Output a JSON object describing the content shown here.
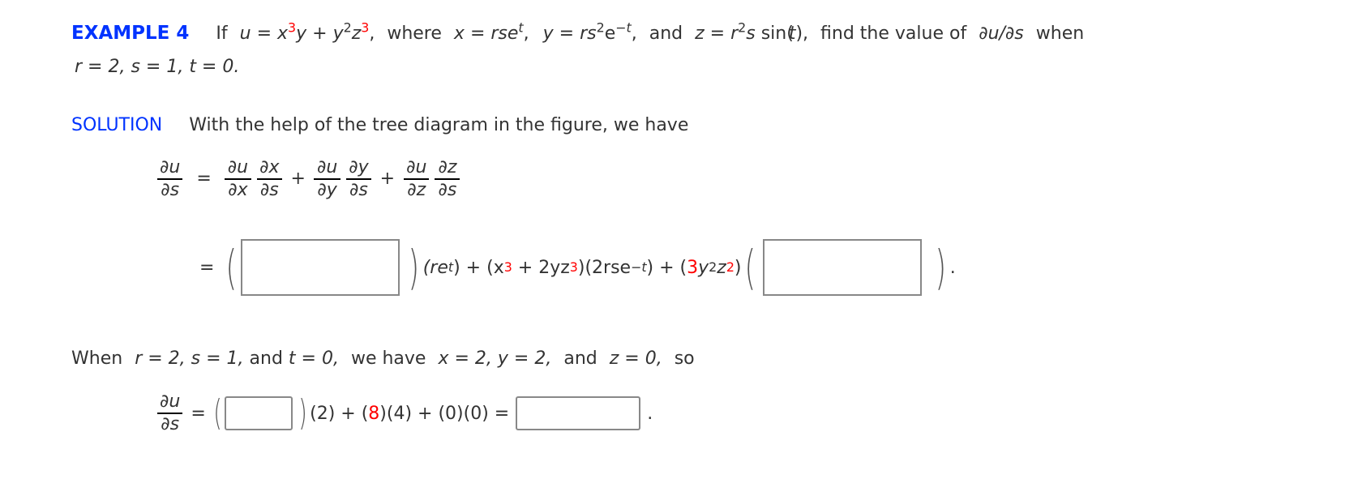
{
  "example": {
    "label": "EXAMPLE 4",
    "if": "If",
    "u": "u",
    "eq": "=",
    "x": "x",
    "sup3": "3",
    "y": "y",
    "plus": "+",
    "sup2": "2",
    "z": "z",
    "comma": ",",
    "where": "where",
    "rse": "rse",
    "t": "t",
    "rs": "rs",
    "e": "e",
    "negt": "−t",
    "and": "and",
    "r": "r",
    "s": "s",
    "sin_open": "sin(",
    "close_paren": ")",
    "find": "find the value of",
    "dudS": "∂u/∂s",
    "when": "when",
    "line2": "r = 2, s = 1, t = 0."
  },
  "solution": {
    "label": "SOLUTION",
    "intro": "With the help of the tree diagram in the figure, we have"
  },
  "chain_rule": {
    "du": "∂u",
    "ds": "∂s",
    "dx": "∂x",
    "dy": "∂y",
    "dz": "∂z",
    "eq": "=",
    "plus": "+"
  },
  "expansion": {
    "eq": "=",
    "term1_open": "(re",
    "term1_sup": "t",
    "term1_close": ") + (x",
    "sup3": "3",
    "mid": " + 2yz",
    "mid_close": ")(2rse",
    "negt": "−t",
    "after": ") + (",
    "three": "3",
    "y": "y",
    "sup2": "2",
    "z": "z",
    "close": ")",
    "period": ".",
    "input1_value": "",
    "input2_value": ""
  },
  "evaluation": {
    "when": "When",
    "r_eq": "r = 2,",
    "s_eq": "s = 1,",
    "and": "and",
    "t_eq": "t = 0,",
    "we_have": "we have",
    "x_eq": "x = 2,",
    "y_eq": "y = 2,",
    "and2": "and",
    "z_eq": "z = 0,",
    "so": "so",
    "du": "∂u",
    "ds": "∂s",
    "eq": "=",
    "after1": "(2) + (",
    "eight": "8",
    "after2": ")(4) + (0)(0) =",
    "period": ".",
    "input1_value": "",
    "input2_value": ""
  }
}
